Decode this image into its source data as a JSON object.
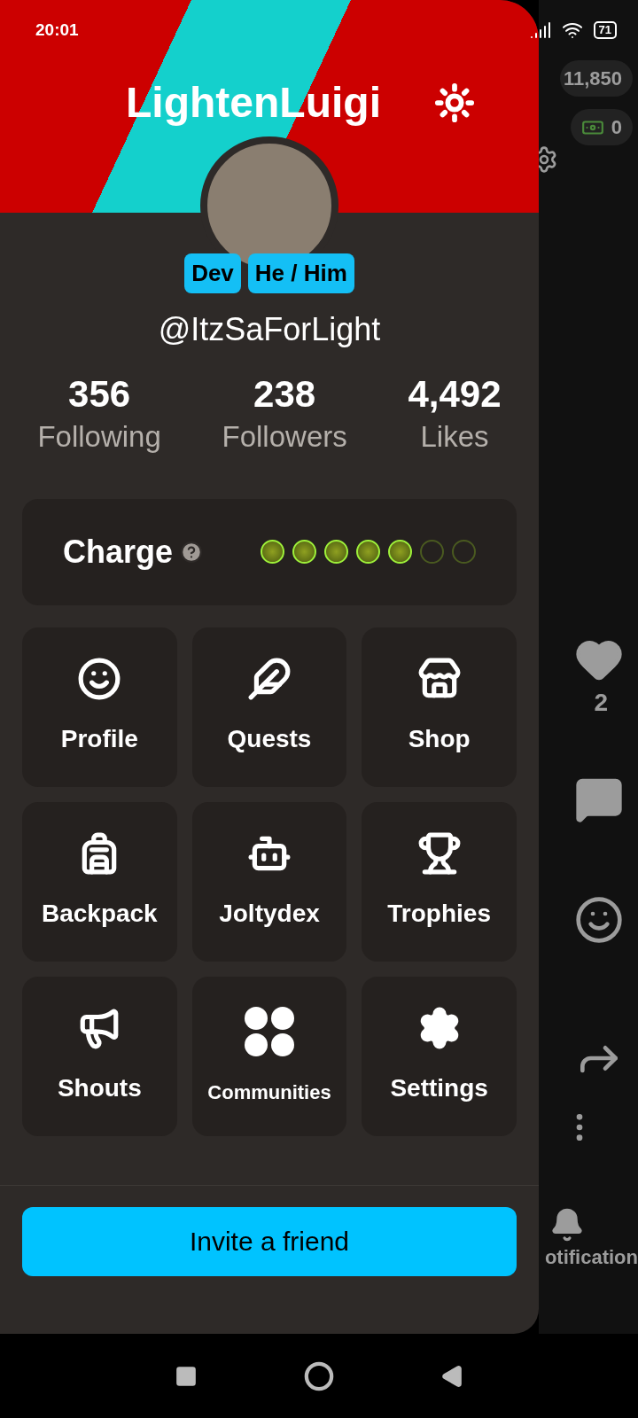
{
  "status_bar": {
    "time": "20:01",
    "battery": "71"
  },
  "drawer": {
    "display_name": "LightenLuigi",
    "badges": [
      "Dev",
      "He / Him"
    ],
    "handle": "@ItzSaForLight",
    "stats": [
      {
        "value": "356",
        "label": "Following"
      },
      {
        "value": "238",
        "label": "Followers"
      },
      {
        "value": "4,492",
        "label": "Likes"
      }
    ],
    "charge": {
      "label": "Charge",
      "pips": [
        {
          "on": true
        },
        {
          "on": true
        },
        {
          "on": true
        },
        {
          "on": true
        },
        {
          "on": true
        },
        {
          "on": false
        },
        {
          "on": false
        }
      ]
    },
    "tiles": [
      {
        "kind": "profile",
        "label": "Profile"
      },
      {
        "kind": "quests",
        "label": "Quests"
      },
      {
        "kind": "shop",
        "label": "Shop"
      },
      {
        "kind": "backpack",
        "label": "Backpack"
      },
      {
        "kind": "joltydex",
        "label": "Joltydex"
      },
      {
        "kind": "trophies",
        "label": "Trophies"
      },
      {
        "kind": "shouts",
        "label": "Shouts"
      },
      {
        "kind": "communities",
        "label": "Communities",
        "small": true
      },
      {
        "kind": "settings",
        "label": "Settings"
      }
    ],
    "invite_button": "Invite a friend"
  },
  "background_app": {
    "coins": "11,850",
    "cash": "0",
    "like_count": "2",
    "nav_label": "otification"
  }
}
